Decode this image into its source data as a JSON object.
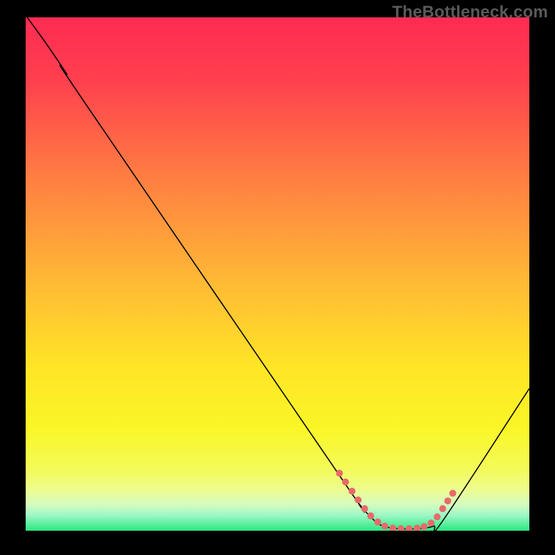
{
  "watermark": "TheBottleneck.com",
  "chart_data": {
    "type": "line",
    "title": "",
    "xlabel": "",
    "ylabel": "",
    "xlim": [
      0,
      100
    ],
    "ylim": [
      0,
      100
    ],
    "background_gradient": {
      "stops": [
        {
          "offset": 0,
          "color": "#ff2b52"
        },
        {
          "offset": 12,
          "color": "#ff3f4e"
        },
        {
          "offset": 30,
          "color": "#ff7a43"
        },
        {
          "offset": 50,
          "color": "#ffb536"
        },
        {
          "offset": 68,
          "color": "#ffe526"
        },
        {
          "offset": 80,
          "color": "#faf626"
        },
        {
          "offset": 88,
          "color": "#f3fb58"
        },
        {
          "offset": 92,
          "color": "#edfc8f"
        },
        {
          "offset": 95,
          "color": "#d4fcc0"
        },
        {
          "offset": 97,
          "color": "#9df7c6"
        },
        {
          "offset": 100,
          "color": "#2ae87f"
        }
      ]
    },
    "series": [
      {
        "name": "bottleneck-curve",
        "color": "#000000",
        "width": 1.6,
        "points": [
          {
            "x": 0.3,
            "y": 100
          },
          {
            "x": 4,
            "y": 95
          },
          {
            "x": 8,
            "y": 89.2
          },
          {
            "x": 12,
            "y": 83
          },
          {
            "x": 62,
            "y": 11.2
          },
          {
            "x": 66,
            "y": 5.5
          },
          {
            "x": 69,
            "y": 2.2
          },
          {
            "x": 71,
            "y": 0.9
          },
          {
            "x": 74,
            "y": 0.4
          },
          {
            "x": 78,
            "y": 0.4
          },
          {
            "x": 81,
            "y": 0.9
          },
          {
            "x": 83,
            "y": 2.2
          },
          {
            "x": 100,
            "y": 27.7
          }
        ]
      },
      {
        "name": "optimal-markers",
        "type": "scatter",
        "color": "#e76a6a",
        "size": 5,
        "points": [
          {
            "x": 62.3,
            "y": 11.2
          },
          {
            "x": 63.5,
            "y": 9.5
          },
          {
            "x": 64.8,
            "y": 7.7
          },
          {
            "x": 66.0,
            "y": 6.0
          },
          {
            "x": 67.3,
            "y": 4.3
          },
          {
            "x": 68.5,
            "y": 2.9
          },
          {
            "x": 69.9,
            "y": 1.7
          },
          {
            "x": 71.3,
            "y": 0.9
          },
          {
            "x": 72.9,
            "y": 0.5
          },
          {
            "x": 74.5,
            "y": 0.4
          },
          {
            "x": 76.1,
            "y": 0.4
          },
          {
            "x": 77.7,
            "y": 0.5
          },
          {
            "x": 79.1,
            "y": 0.8
          },
          {
            "x": 80.5,
            "y": 1.5
          },
          {
            "x": 81.7,
            "y": 2.7
          },
          {
            "x": 82.8,
            "y": 4.3
          },
          {
            "x": 83.8,
            "y": 5.8
          },
          {
            "x": 84.8,
            "y": 7.3
          }
        ]
      }
    ]
  }
}
